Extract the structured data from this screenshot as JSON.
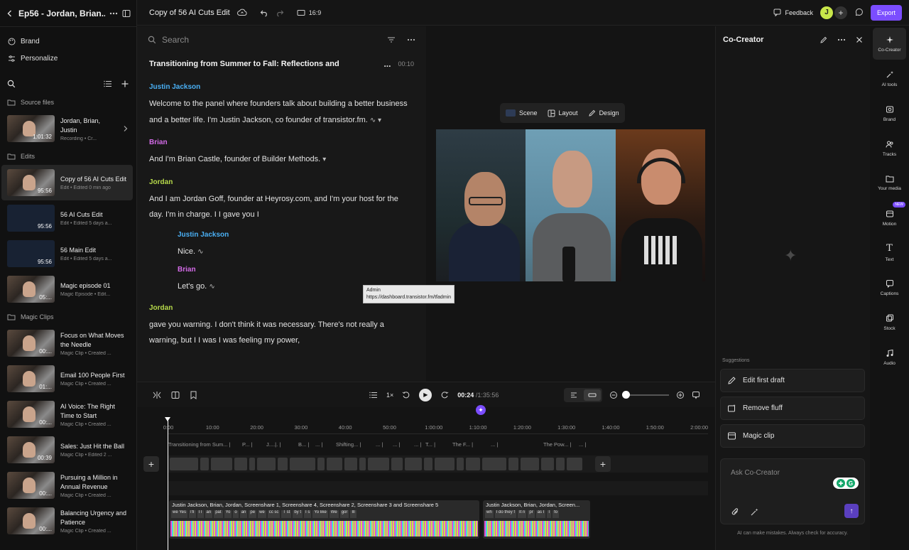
{
  "sidebar": {
    "project_title": "Ep56 - Jordan, Brian...",
    "links": [
      {
        "label": "Brand"
      },
      {
        "label": "Personalize"
      }
    ],
    "sections": {
      "source": "Source files",
      "edits": "Edits",
      "magic": "Magic Clips"
    },
    "source_files": [
      {
        "name": "Jordan, Brian, Justin",
        "sub": "Recording • Cr...",
        "duration": "1:01:32"
      }
    ],
    "edits": [
      {
        "name": "Copy of 56 AI Cuts Edit",
        "sub": "Edit • Edited 0 min ago",
        "duration": "95:56"
      },
      {
        "name": "56 AI Cuts Edit",
        "sub": "Edit • Edited 5 days a...",
        "duration": "95:56"
      },
      {
        "name": "56 Main Edit",
        "sub": "Edit • Edited 5 days a...",
        "duration": "95:56"
      },
      {
        "name": "Magic episode 01",
        "sub": "Magic Episode • Edit...",
        "duration": "05:..."
      }
    ],
    "magic_clips": [
      {
        "name": "Focus on What Moves the Needle",
        "sub": "Magic Clip • Created ...",
        "duration": "00:..."
      },
      {
        "name": "Email 100 People First",
        "sub": "Magic Clip • Created ...",
        "duration": "01:..."
      },
      {
        "name": "AI Voice: The Right Time to Start",
        "sub": "Magic Clip • Created ...",
        "duration": "00:..."
      },
      {
        "name": "Sales: Just Hit the Ball",
        "sub": "Magic Clip • Edited 2 ...",
        "duration": "00:39"
      },
      {
        "name": "Pursuing a Million in Annual Revenue",
        "sub": "Magic Clip • Created ...",
        "duration": "00:..."
      },
      {
        "name": "Balancing Urgency and Patience",
        "sub": "Magic Clip • Created ...",
        "duration": "00:..."
      }
    ]
  },
  "topbar": {
    "project_name": "Copy of 56 AI Cuts Edit",
    "aspect_ratio": "16:9",
    "feedback": "Feedback",
    "avatar_initial": "J",
    "export": "Export"
  },
  "transcript": {
    "search_placeholder": "Search",
    "title": "Transitioning from Summer to Fall: Reflections and",
    "title_more": "...",
    "title_time": "00:10",
    "blocks": [
      {
        "speaker": "Justin Jackson",
        "text": "Welcome to the panel where founders talk about building a better business and a better life. I'm Justin Jackson, co founder of transistor.fm."
      },
      {
        "speaker": "Brian",
        "text": "And I'm Brian Castle, founder of Builder Methods."
      },
      {
        "speaker": "Jordan",
        "text": "And I am Jordan Goff, founder at Heyrosy.com, and I'm your host for the day. I'm in charge. I I gave you I"
      },
      {
        "speaker": "Justin Jackson",
        "text": "Nice."
      },
      {
        "speaker": "Brian",
        "text": "Let's go."
      },
      {
        "speaker": "Jordan",
        "text": "gave you warning. I don't think it was necessary. There's not really a warning, but I I was I was feeling my power,"
      }
    ]
  },
  "preview": {
    "scene": "Scene",
    "layout": "Layout",
    "design": "Design",
    "tooltip_title": "Admin",
    "tooltip_url": "https://dashboard.transistor.fm/tfadmin"
  },
  "cocreator": {
    "title": "Co-Creator",
    "suggestions_label": "Suggestions",
    "suggestions": [
      "Edit first draft",
      "Remove fluff",
      "Magic clip"
    ],
    "ask_placeholder": "Ask Co-Creator",
    "disclaimer": "AI can make mistakes. Always check for accuracy."
  },
  "rail": {
    "items": [
      "Co-Creator",
      "AI tools",
      "Brand",
      "Tracks",
      "Your media",
      "Motion",
      "Text",
      "Captions",
      "Stock",
      "Audio"
    ],
    "new_badge": "NEW"
  },
  "playback": {
    "speed": "1×",
    "current_time": "00:24",
    "total_time": "/1:35:56"
  },
  "timeline": {
    "ticks": [
      "0:00",
      "10:00",
      "20:00",
      "30:00",
      "40:00",
      "50:00",
      "1:00:00",
      "1:10:00",
      "1:20:00",
      "1:30:00",
      "1:40:00",
      "1:50:00",
      "2:00:00"
    ],
    "chapters": [
      "Transitioning from Sum...",
      "P...",
      "J...",
      "...",
      "B...",
      "...",
      "Shifting...",
      "...",
      "...",
      "...",
      "T...",
      "The F...",
      "...",
      "The Pow...",
      "..."
    ],
    "clip1_label": "Justin Jackson, Brian, Jordan, Screenshare 1, Screenshare 4, Screenshare 2, Screenshare 3 and Screenshare 5",
    "clip2_label": "Justin Jackson, Brian, Jordan, Screen...",
    "clip1_words": [
      "we Yes",
      "I'll",
      "I I",
      "an",
      "pat",
      "Yo",
      "o",
      "an",
      "pe",
      "we",
      "cc sc",
      "T st",
      "by t",
      "I s",
      "Yo like",
      "We",
      "gor",
      "Ill"
    ],
    "clip2_words": [
      "wh",
      "I do they f",
      "It n",
      "pr",
      "as I",
      "I",
      "fo"
    ]
  },
  "colors": {
    "accent": "#7b4dff",
    "justin": "#4ab0f5",
    "brian": "#d46be8",
    "jordan": "#b6d94a"
  }
}
